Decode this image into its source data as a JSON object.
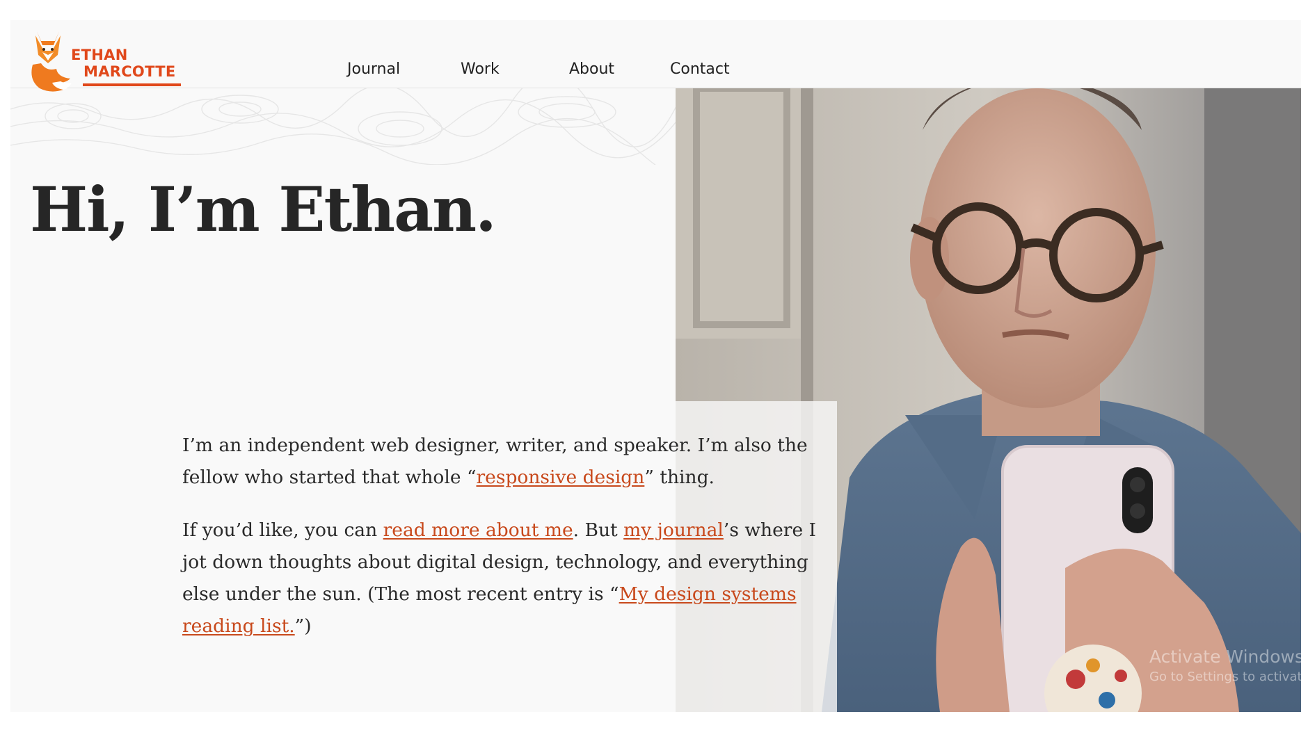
{
  "header": {
    "logo": {
      "line1": "ETHAN",
      "line2": "MARCOTTE"
    },
    "nav": [
      {
        "label": "Journal"
      },
      {
        "label": "Work"
      },
      {
        "label": "About"
      },
      {
        "label": "Contact"
      }
    ]
  },
  "hero": {
    "title": "Hi, I’m Ethan.",
    "photo_icon": "person-selfie-photo"
  },
  "intro": {
    "p1": {
      "before": "I’m an independent web designer, writer, and speaker. I’m also the fellow who started that whole “",
      "link": "responsive design",
      "after": "” thing."
    },
    "p2": {
      "before": "If you’d like, you can ",
      "link1": "read more about me",
      "mid1": ". But ",
      "link2": "my journal",
      "mid2": "’s where I jot down thoughts about digital design, technology, and everything else under the sun. (The most recent entry is “",
      "link3": "My design systems reading list.",
      "after": "”)"
    }
  },
  "watermark": {
    "title": "Activate Windows",
    "subtitle": "Go to Settings to activate Windows."
  },
  "colors": {
    "accent": "#e0481b",
    "link": "#c8491c",
    "text": "#262626",
    "background": "#f9f9f9"
  }
}
